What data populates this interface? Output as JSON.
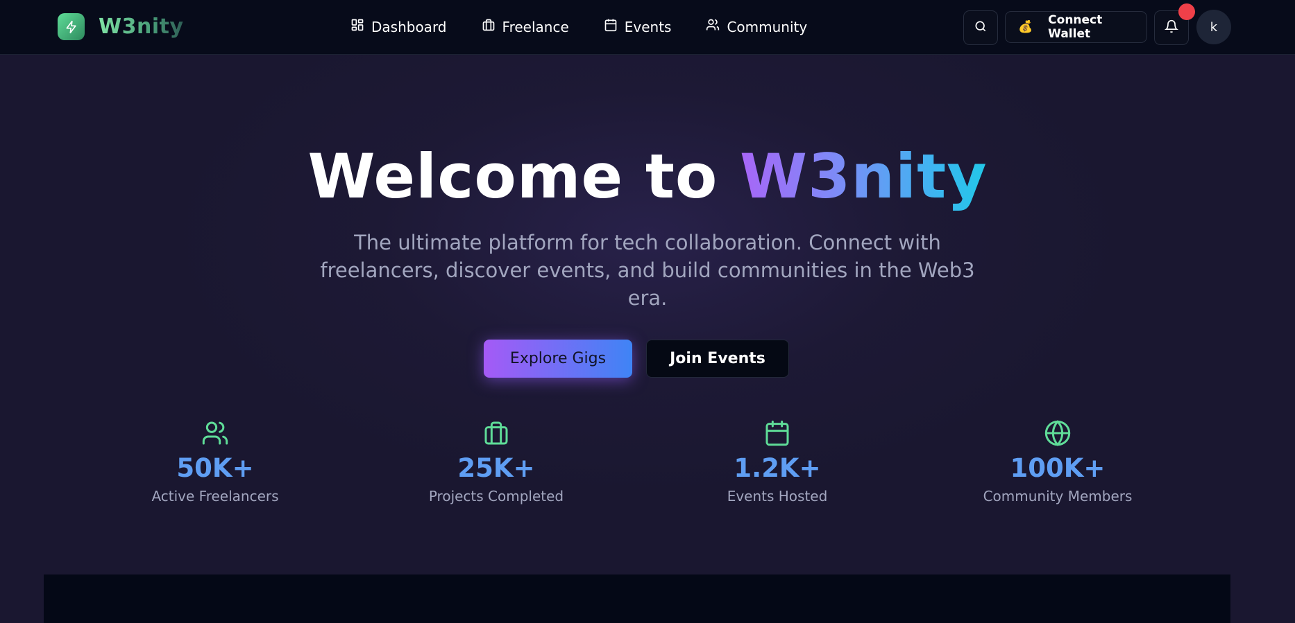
{
  "brand": {
    "name": "W3nity"
  },
  "nav": {
    "items": [
      {
        "label": "Dashboard",
        "icon": "dashboard-icon"
      },
      {
        "label": "Freelance",
        "icon": "briefcase-icon"
      },
      {
        "label": "Events",
        "icon": "calendar-icon"
      },
      {
        "label": "Community",
        "icon": "users-icon"
      }
    ]
  },
  "header": {
    "wallet_label": "Connect Wallet",
    "wallet_emoji": "💰",
    "avatar_initial": "k"
  },
  "hero": {
    "title_prefix": "Welcome to",
    "title_brand": "W3nity",
    "subtitle": "The ultimate platform for tech collaboration. Connect with freelancers, discover events, and build communities in the Web3 era.",
    "primary_cta": "Explore Gigs",
    "secondary_cta": "Join Events"
  },
  "stats": [
    {
      "value": "50K+",
      "label": "Active Freelancers",
      "icon": "users-icon"
    },
    {
      "value": "25K+",
      "label": "Projects Completed",
      "icon": "briefcase-icon"
    },
    {
      "value": "1.2K+",
      "label": "Events Hosted",
      "icon": "calendar-icon"
    },
    {
      "value": "100K+",
      "label": "Community Members",
      "icon": "globe-icon"
    }
  ],
  "colors": {
    "accent_green": "#5fdc98",
    "stat_blue": "#5f9ef3",
    "gradient_purple": "#a55af6",
    "gradient_blue": "#3f84f5",
    "notification_red": "#ef4049"
  }
}
